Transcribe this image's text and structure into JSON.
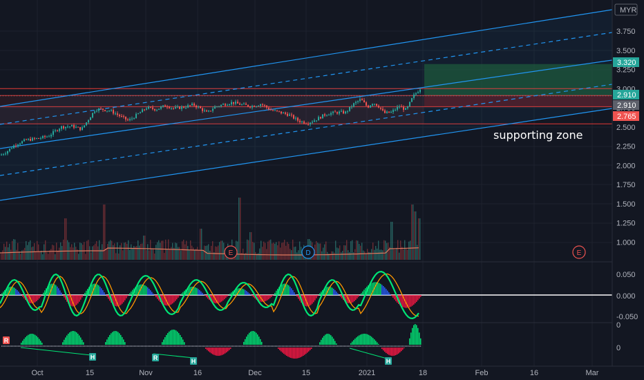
{
  "currency": "MYR",
  "annotation": "supporting zone",
  "colors": {
    "background": "#131722",
    "grid": "#1e222d",
    "up": "#26a69a",
    "down": "#ef5350",
    "channel": "#2196f3",
    "volume_ma": "#e07a5f",
    "target_zone": "#1e5631",
    "stop_zone": "#5a1a22",
    "support_lines": "#e53935",
    "mom_green": "#00e676",
    "mom_red": "#ff1744",
    "mom_blue": "#2962ff",
    "mom_orange": "#ff9800"
  },
  "price_axis": {
    "ticks": [
      "3.750",
      "3.500",
      "3.250",
      "3.000",
      "2.750",
      "2.500",
      "2.250",
      "2.000",
      "1.750",
      "1.500",
      "1.250",
      "1.000"
    ],
    "labels": [
      {
        "text": "3.320",
        "color": "#26a69a"
      },
      {
        "text": "2.910",
        "color": "#26a69a"
      },
      {
        "text": "2.910",
        "color": "#5d606b"
      },
      {
        "text": "2.765",
        "color": "#ef5350"
      }
    ]
  },
  "oscillator_axis": {
    "ticks": [
      "0.050",
      "0.000",
      "-0.050"
    ]
  },
  "momentum_axis": {
    "ticks": [
      "0",
      "0"
    ]
  },
  "time_axis": [
    "Oct",
    "15",
    "Nov",
    "16",
    "Dec",
    "15",
    "2021",
    "18",
    "Feb",
    "16",
    "Mar"
  ],
  "events": [
    {
      "letter": "E",
      "color": "#ef5350"
    },
    {
      "letter": "D",
      "color": "#2196f3"
    },
    {
      "letter": "E",
      "color": "#ef5350"
    }
  ],
  "badges": [
    {
      "letter": "R",
      "color": "#ef5350"
    },
    {
      "letter": "H",
      "color": "#26a69a"
    },
    {
      "letter": "R",
      "color": "#26a69a"
    },
    {
      "letter": "H",
      "color": "#26a69a"
    },
    {
      "letter": "H",
      "color": "#26a69a"
    }
  ],
  "chart_data": {
    "type": "candlestick",
    "y_range": [
      0.82,
      3.98
    ],
    "support_levels": [
      2.54,
      2.765,
      2.91,
      3.0
    ],
    "target_zone": [
      2.91,
      3.32
    ],
    "stop_zone": [
      2.765,
      2.91
    ],
    "price_anchors": {
      "t": [
        0,
        10,
        22,
        38,
        55,
        70,
        88,
        105,
        118,
        138,
        148,
        160,
        176,
        186,
        200,
        212,
        226,
        240,
        252,
        266,
        280,
        290,
        300,
        310,
        322,
        336,
        350,
        364,
        378,
        392,
        405,
        418,
        432,
        445,
        458,
        472,
        488,
        500,
        512,
        522,
        532,
        540,
        548,
        556,
        566,
        578,
        588,
        598,
        608
      ],
      "v": [
        2.13,
        2.18,
        2.27,
        2.33,
        2.35,
        2.38,
        2.5,
        2.51,
        2.47,
        2.73,
        2.73,
        2.71,
        2.63,
        2.58,
        2.67,
        2.75,
        2.73,
        2.78,
        2.74,
        2.76,
        2.79,
        2.74,
        2.68,
        2.76,
        2.79,
        2.82,
        2.79,
        2.77,
        2.8,
        2.72,
        2.69,
        2.66,
        2.58,
        2.55,
        2.6,
        2.67,
        2.69,
        2.69,
        2.8,
        2.86,
        2.76,
        2.82,
        2.77,
        2.68,
        2.69,
        2.77,
        2.72,
        2.9,
        3.0
      ]
    }
  }
}
